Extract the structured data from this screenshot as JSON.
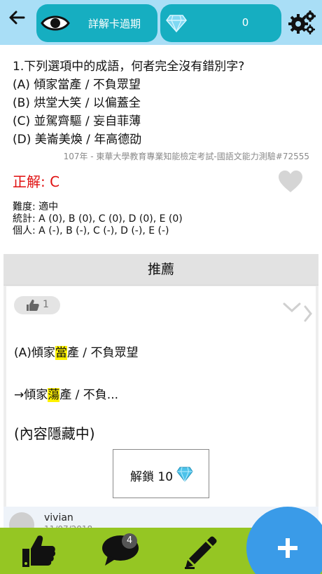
{
  "header": {
    "back_icon": "arrow-left-icon",
    "card_label": "詳解卡過期",
    "eye_icon": "eye-icon",
    "gem_icon": "diamond-icon",
    "gem_count": "0",
    "settings_icon": "gears-icon",
    "bg_color": "#a9def6",
    "pill_color": "#16aec1"
  },
  "question": {
    "text": "1.下列選項中的成語，何者完全沒有錯別字?",
    "options": [
      "(A) 傾家當產 / 不負眾望",
      "(B) 烘堂大笑 / 以偏蓋全",
      "(C) 並駕齊驅 / 妄自菲薄",
      "(D) 美崙美煥 / 年高德劭"
    ],
    "source": "107年 - 東華大學教育專業知能檢定考試-國語文能力測驗#72555",
    "answer": "正解: C",
    "answer_color": "#e01010"
  },
  "stats": {
    "difficulty_label": "難度:",
    "difficulty_value": "適中",
    "stats_label": "統計:",
    "stats_value": "A (0), B (0), C (0), D (0), E (0)",
    "personal_label": "個人:",
    "personal_value": "A (-), B (-), C (-), D (-), E (-)"
  },
  "recommend": {
    "title": "推薦",
    "like_count": "1",
    "line1_pre": "(A)傾家",
    "line1_hl": "當",
    "line1_post": "產 / 不負眾望",
    "line2_pre": "→傾家",
    "line2_hl": "蕩",
    "line2_post": "產 / 不負...",
    "hidden_note": "(內容隱藏中)",
    "unlock_label": "解鎖 10",
    "commenter": "vivian",
    "comment_date": "11/07/2018"
  },
  "bottom": {
    "chat_badge": "4",
    "bar_color": "#95c623",
    "fab_color": "#3a9be8"
  }
}
